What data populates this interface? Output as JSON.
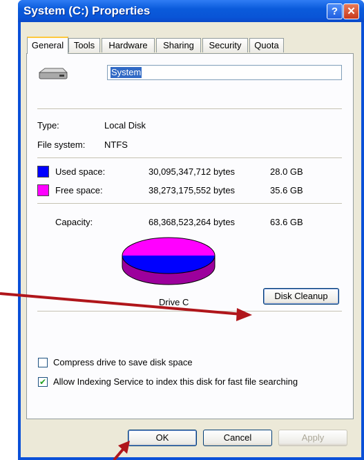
{
  "window": {
    "title": "System (C:) Properties",
    "help_label": "?",
    "close_label": "✕"
  },
  "tabs": [
    {
      "label": "General"
    },
    {
      "label": "Tools"
    },
    {
      "label": "Hardware"
    },
    {
      "label": "Sharing"
    },
    {
      "label": "Security"
    },
    {
      "label": "Quota"
    }
  ],
  "general": {
    "drive_name": "System",
    "type_label": "Type:",
    "type_value": "Local Disk",
    "fs_label": "File system:",
    "fs_value": "NTFS",
    "used": {
      "label": "Used space:",
      "bytes": "30,095,347,712 bytes",
      "size": "28.0 GB",
      "color": "#0000ff"
    },
    "free": {
      "label": "Free space:",
      "bytes": "38,273,175,552 bytes",
      "size": "35.6 GB",
      "color": "#ff00ff"
    },
    "capacity": {
      "label": "Capacity:",
      "bytes": "68,368,523,264 bytes",
      "size": "63.6 GB"
    },
    "drive_label": "Drive C",
    "disk_cleanup_label": "Disk Cleanup",
    "compress_label": "Compress drive to save disk space",
    "compress_checked": false,
    "indexing_label": "Allow Indexing Service to index this disk for fast file searching",
    "indexing_checked": true
  },
  "buttons": {
    "ok": "OK",
    "cancel": "Cancel",
    "apply": "Apply"
  },
  "annotation_color": "#b0161b"
}
